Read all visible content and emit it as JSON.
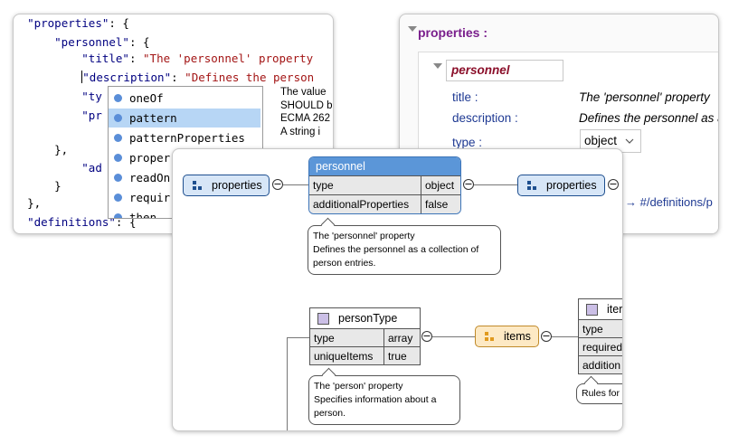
{
  "code_editor": {
    "lines": [
      {
        "indent": "  ",
        "key": "\"properties\"",
        "rest": ": {"
      },
      {
        "indent": "      ",
        "key": "\"personnel\"",
        "rest": ": {"
      },
      {
        "indent": "          ",
        "key": "\"title\"",
        "rest": ": ",
        "str": "\"The 'personnel' property"
      },
      {
        "indent": "          ",
        "key": "\"description\"",
        "rest": ": ",
        "str": "\"Defines the person"
      },
      {
        "indent": "          ",
        "key": "\"ty",
        "rest": "",
        "str": ""
      },
      {
        "indent": "          ",
        "key": "\"pr",
        "rest": "",
        "str": ""
      },
      {
        "indent": "          ",
        "key": "",
        "rest": "",
        "str": ""
      },
      {
        "indent": "      ",
        "key": "",
        "rest": "},",
        "str": ""
      },
      {
        "indent": "          ",
        "key": "\"ad",
        "rest": "",
        "str": ""
      },
      {
        "indent": "      ",
        "key": "",
        "rest": "}",
        "str": ""
      },
      {
        "indent": "  ",
        "key": "",
        "rest": "},",
        "str": ""
      },
      {
        "indent": "  ",
        "key": "\"definitions\"",
        "rest": ": {",
        "str": ""
      }
    ],
    "autocomplete": [
      {
        "label": "oneOf",
        "selected": false
      },
      {
        "label": "pattern",
        "selected": true
      },
      {
        "label": "patternProperties",
        "selected": false
      },
      {
        "label": "proper",
        "selected": false
      },
      {
        "label": "readOn",
        "selected": false
      },
      {
        "label": "requir",
        "selected": false
      },
      {
        "label": "then",
        "selected": false
      }
    ],
    "doc_lines": [
      "The value",
      "SHOULD b",
      "ECMA 262",
      "A string i"
    ]
  },
  "form_view": {
    "heading": "properties :",
    "property_name": "personnel",
    "fields": [
      {
        "label": "title :",
        "value": "The 'personnel' property"
      },
      {
        "label": "description :",
        "value": "Defines the personnel as a"
      },
      {
        "label": "type :",
        "value": "object"
      }
    ],
    "ref_text": "→ #/definitions/p"
  },
  "diagram": {
    "properties_node_left": "properties",
    "properties_node_right": "properties",
    "personnel_box": {
      "title": "personnel",
      "rows": [
        {
          "key": "type",
          "value": "object"
        },
        {
          "key": "additionalProperties",
          "value": "false"
        }
      ]
    },
    "personnel_tip": [
      "The 'personnel' property",
      "Defines the personnel as a collection of",
      "person entries."
    ],
    "persontype_box": {
      "title": "personType",
      "rows": [
        {
          "key": "type",
          "value": "array"
        },
        {
          "key": "uniqueItems",
          "value": "true"
        }
      ]
    },
    "persontype_tip": [
      "The 'person' property",
      "Specifies information about a",
      "person."
    ],
    "items_node": "items",
    "item_box": {
      "title": "iter",
      "rows": [
        {
          "key": "type",
          "value": ""
        },
        {
          "key": "required",
          "value": ""
        },
        {
          "key": "addition",
          "value": ""
        }
      ]
    },
    "item_tip": "Rules for",
    "minus_symbol": "−",
    "colors": {
      "header_blue": "#5b96d8",
      "ref_blue": "#d7e6f7",
      "items_orange": "#fde9c4",
      "heading_purple": "#7a1f8c"
    }
  }
}
